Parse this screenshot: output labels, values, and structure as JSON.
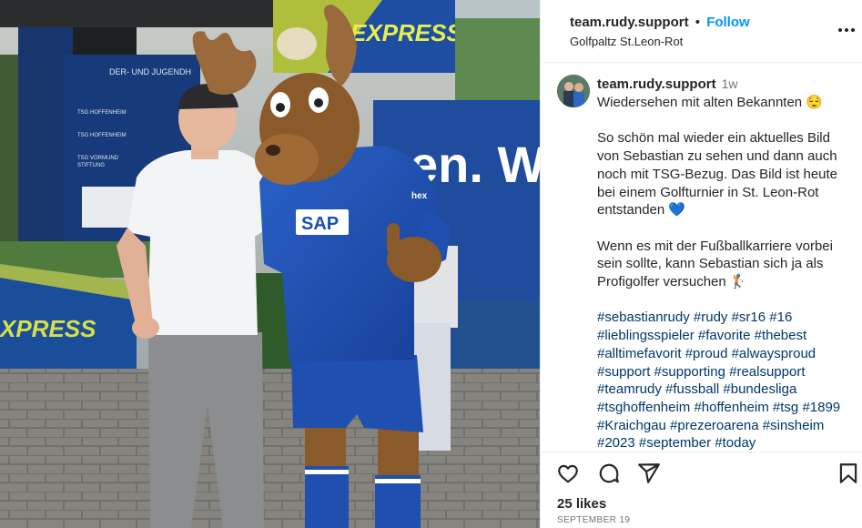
{
  "post": {
    "image_alt": "Player in white shirt next to mascot in blue SAP jersey",
    "photo_texts": {
      "banner_express": "EXPRESS",
      "banner_left_express": "XPRESS",
      "truck_slogan": "en. W",
      "jersey_sponsor": "SAP",
      "sponsor_small": "hex",
      "sign_header": "DER- UND JUGENDH",
      "sign_l1": "TSG HOFFENHEIM",
      "sign_l2": "TSG HOFFENHEIM",
      "sign_l3": "TSG VORMUND",
      "sign_l4": "STIFTUNG"
    }
  },
  "header": {
    "username": "team.rudy.support",
    "separator": "•",
    "follow_label": "Follow",
    "location": "Golfpaltz St.Leon-Rot"
  },
  "caption": {
    "username": "team.rudy.support",
    "time_ago": "1w",
    "line1": "Wiedersehen mit alten Bekannten 😌",
    "para2": "So schön mal wieder ein aktuelles Bild von Sebastian zu sehen und dann auch noch mit TSG-Bezug. Das Bild ist heute bei einem Golfturnier in St. Leon-Rot entstanden 💙",
    "para3": "Wenn es mit der Fußballkarriere vorbei sein sollte, kann Sebastian sich ja als Profigolfer versuchen 🏌",
    "hashtags": "#sebastianrudy #rudy #sr16 #16 #lieblingsspieler #favorite #thebest #alltimefavorit #proud #alwaysproud #support #supporting #realsupport #teamrudy #fussball #bundesliga #tsghoffenheim #hoffenheim #tsg #1899 #Kraichgau #prezeroarena #sinsheim #2023 #september #today"
  },
  "actions": {
    "like_icon": "heart-icon",
    "comment_icon": "comment-icon",
    "share_icon": "share-icon",
    "save_icon": "bookmark-icon",
    "likes_text": "25 likes",
    "date_text": "SEPTEMBER 19"
  },
  "colors": {
    "link_blue": "#0095f6",
    "hashtag_blue": "#00376b",
    "muted": "#737373",
    "jersey_blue": "#1a4fb5"
  }
}
